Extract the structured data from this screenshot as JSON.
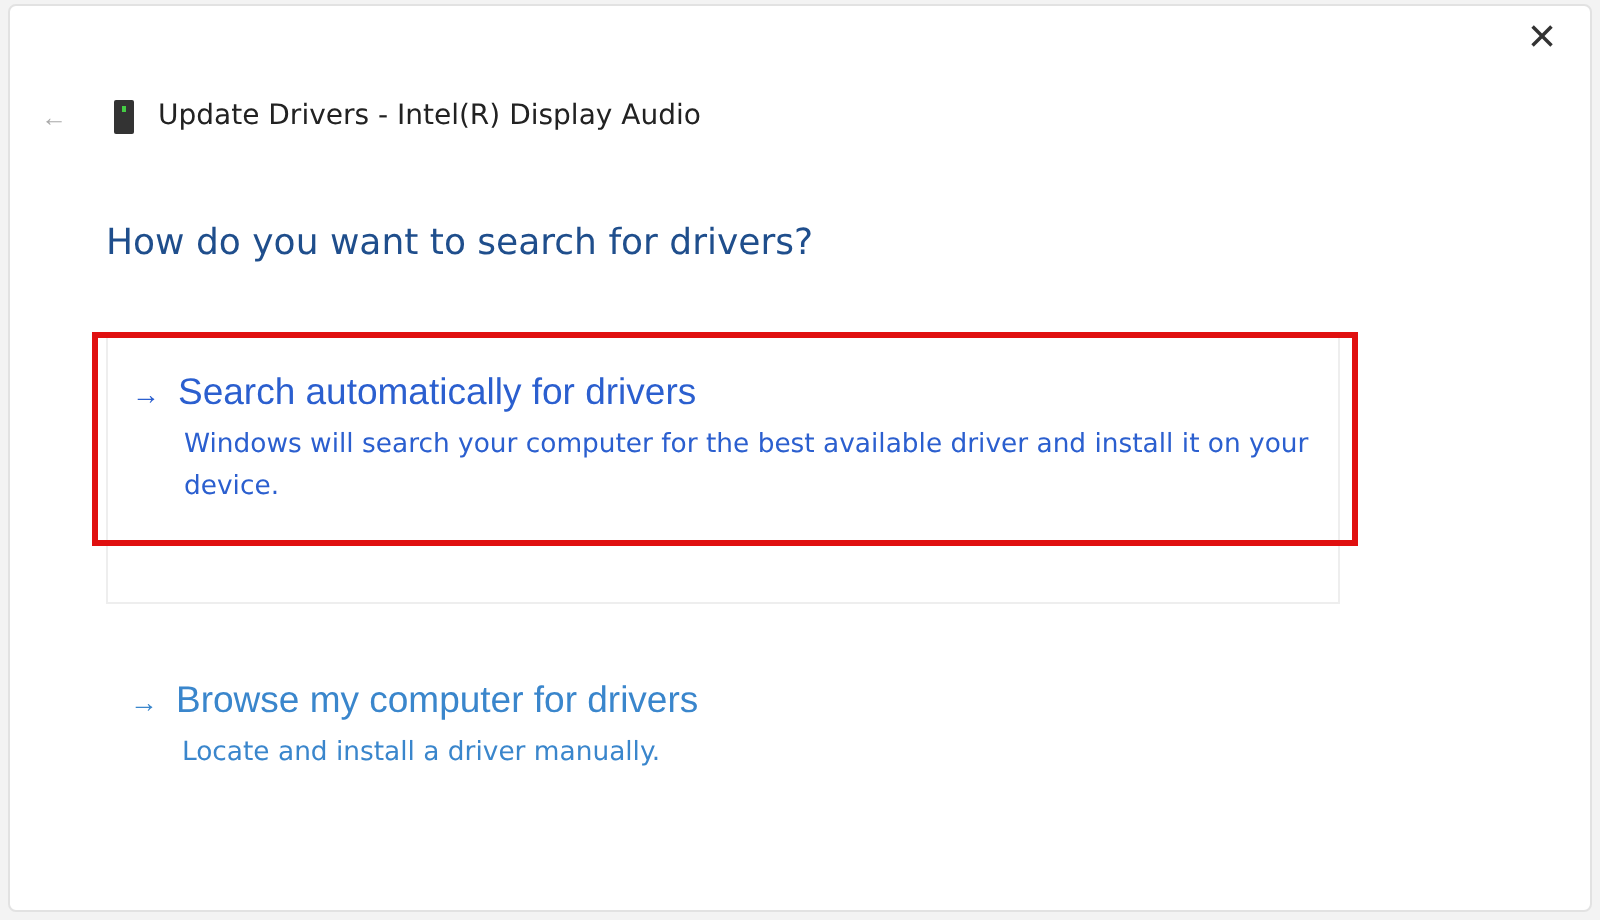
{
  "window": {
    "title": "Update Drivers - Intel(R) Display Audio",
    "close": "×",
    "back": "←"
  },
  "heading": "How do you want to search for drivers?",
  "options": [
    {
      "arrow": "→",
      "title": "Search automatically for drivers",
      "description": "Windows will search your computer for the best available driver and install it on your device.",
      "highlighted": true
    },
    {
      "arrow": "→",
      "title": "Browse my computer for drivers",
      "description": "Locate and install a driver manually.",
      "highlighted": false
    }
  ]
}
